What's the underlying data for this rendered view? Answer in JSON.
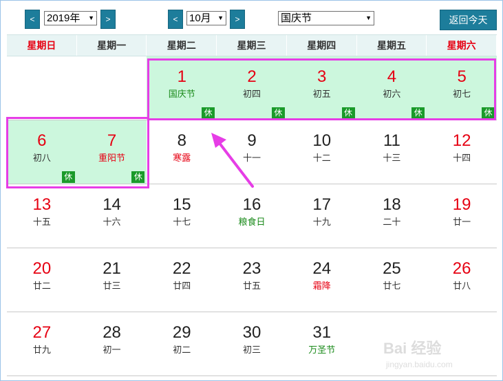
{
  "toolbar": {
    "prev_year": "<",
    "year_value": "2019年",
    "next_year": ">",
    "prev_month": "<",
    "month_value": "10月",
    "next_month": ">",
    "holiday_value": "国庆节",
    "today_label": "返回今天"
  },
  "weekdays": [
    "星期日",
    "星期一",
    "星期二",
    "星期三",
    "星期四",
    "星期五",
    "星期六"
  ],
  "rest_badge": "休",
  "colors": {
    "highlight": "#e63de6",
    "holiday_bg": "#ccf7dd",
    "weekend": "#e60012",
    "rest_badge": "#1a9a2a",
    "nav": "#1d7d9b"
  },
  "weeks": [
    [
      null,
      null,
      {
        "day": "1",
        "lunar": "国庆节",
        "rest": true,
        "lunar_style": "green"
      },
      {
        "day": "2",
        "lunar": "初四",
        "rest": true
      },
      {
        "day": "3",
        "lunar": "初五",
        "rest": true
      },
      {
        "day": "4",
        "lunar": "初六",
        "rest": true
      },
      {
        "day": "5",
        "lunar": "初七",
        "rest": true
      }
    ],
    [
      {
        "day": "6",
        "lunar": "初八",
        "rest": true
      },
      {
        "day": "7",
        "lunar": "重阳节",
        "rest": true,
        "lunar_style": "red"
      },
      {
        "day": "8",
        "lunar": "寒露",
        "lunar_style": "red"
      },
      {
        "day": "9",
        "lunar": "十一"
      },
      {
        "day": "10",
        "lunar": "十二"
      },
      {
        "day": "11",
        "lunar": "十三"
      },
      {
        "day": "12",
        "lunar": "十四"
      }
    ],
    [
      {
        "day": "13",
        "lunar": "十五"
      },
      {
        "day": "14",
        "lunar": "十六"
      },
      {
        "day": "15",
        "lunar": "十七"
      },
      {
        "day": "16",
        "lunar": "粮食日",
        "lunar_style": "green"
      },
      {
        "day": "17",
        "lunar": "十九"
      },
      {
        "day": "18",
        "lunar": "二十"
      },
      {
        "day": "19",
        "lunar": "廿一"
      }
    ],
    [
      {
        "day": "20",
        "lunar": "廿二"
      },
      {
        "day": "21",
        "lunar": "廿三"
      },
      {
        "day": "22",
        "lunar": "廿四"
      },
      {
        "day": "23",
        "lunar": "廿五"
      },
      {
        "day": "24",
        "lunar": "霜降",
        "lunar_style": "red"
      },
      {
        "day": "25",
        "lunar": "廿七"
      },
      {
        "day": "26",
        "lunar": "廿八"
      }
    ],
    [
      {
        "day": "27",
        "lunar": "廿九"
      },
      {
        "day": "28",
        "lunar": "初一"
      },
      {
        "day": "29",
        "lunar": "初二"
      },
      {
        "day": "30",
        "lunar": "初三"
      },
      {
        "day": "31",
        "lunar": "万圣节",
        "lunar_style": "green"
      },
      null,
      null
    ]
  ],
  "watermark": {
    "brand": "Bai 经验",
    "url": "jingyan.baidu.com"
  }
}
